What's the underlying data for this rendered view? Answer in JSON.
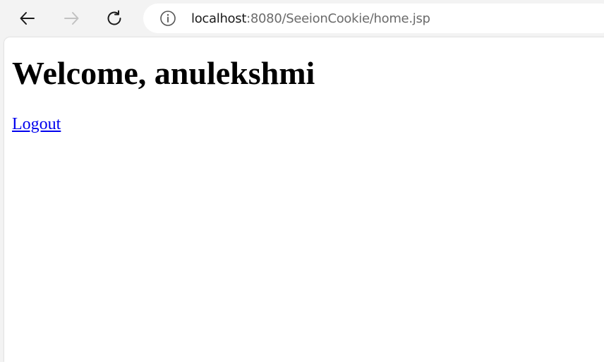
{
  "browser": {
    "back_icon": "arrow-left-icon",
    "forward_icon": "arrow-right-icon",
    "forward_enabled": false,
    "reload_icon": "reload-icon",
    "info_icon": "info-circle-icon",
    "url_host": "localhost",
    "url_rest": ":8080/SeeionCookie/home.jsp"
  },
  "page": {
    "heading": "Welcome, anulekshmi",
    "logout_label": "Logout",
    "link_color": "#0000ee"
  }
}
